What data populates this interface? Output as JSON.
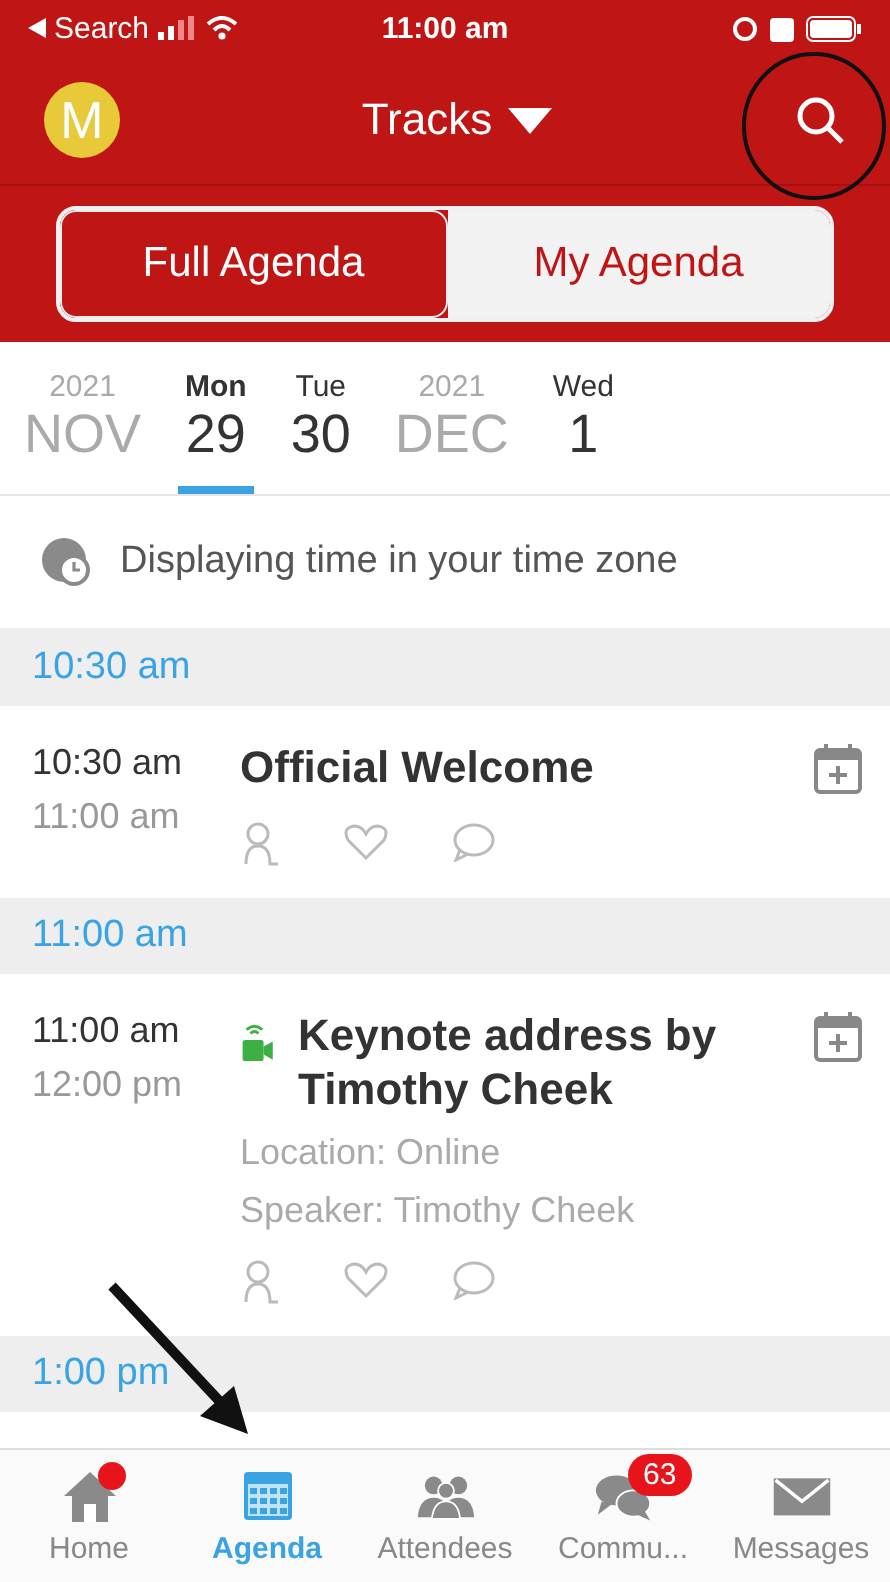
{
  "status_bar": {
    "back_label": "Search",
    "time": "11:00 am"
  },
  "header": {
    "avatar_letter": "M",
    "title": "Tracks"
  },
  "segments": [
    {
      "label": "Full Agenda",
      "selected": true
    },
    {
      "label": "My Agenda",
      "selected": false
    }
  ],
  "dates": [
    {
      "kind": "month",
      "year": "2021",
      "month": "NOV"
    },
    {
      "kind": "day",
      "weekday": "Mon",
      "day": "29",
      "selected": true
    },
    {
      "kind": "day",
      "weekday": "Tue",
      "day": "30",
      "selected": false
    },
    {
      "kind": "month",
      "year": "2021",
      "month": "DEC"
    },
    {
      "kind": "day",
      "weekday": "Wed",
      "day": "1",
      "selected": false
    }
  ],
  "timezone_note": "Displaying time in your time zone",
  "schedule": [
    {
      "time_header": "10:30 am",
      "sessions": [
        {
          "start": "10:30 am",
          "end": "11:00 am",
          "title": "Official Welcome",
          "online": false
        }
      ]
    },
    {
      "time_header": "11:00 am",
      "sessions": [
        {
          "start": "11:00 am",
          "end": "12:00 pm",
          "title": "Keynote address by Timothy Cheek",
          "online": true,
          "details": [
            "Location: Online",
            "Speaker: Timothy Cheek"
          ]
        }
      ]
    },
    {
      "time_header": "1:00 pm"
    }
  ],
  "tabs": [
    {
      "kind": "home",
      "label": "Home",
      "selected": false,
      "dot": true
    },
    {
      "kind": "agenda",
      "label": "Agenda",
      "selected": true
    },
    {
      "kind": "attendees",
      "label": "Attendees",
      "selected": false
    },
    {
      "kind": "community",
      "label": "Commu...",
      "selected": false,
      "badge": "63"
    },
    {
      "kind": "messages",
      "label": "Messages",
      "selected": false
    }
  ]
}
